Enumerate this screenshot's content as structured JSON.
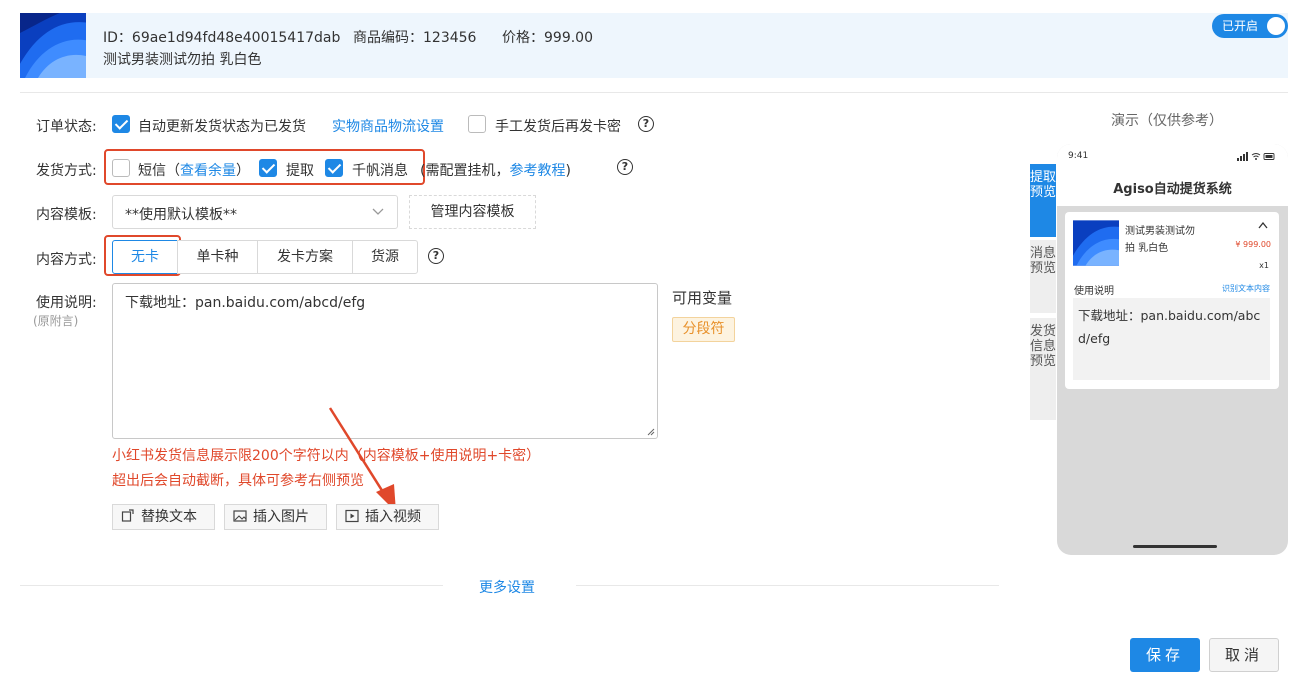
{
  "product": {
    "id_text": "ID：69ae1d94fd48e40015417dab",
    "code_text": "商品编码：123456",
    "price_text": "价格：999.00",
    "name": "测试男装测试勿拍 乳白色",
    "toggle_label": "已开启"
  },
  "order_status": {
    "label": "订单状态:",
    "auto_update": "自动更新发货状态为已发货",
    "logistics_link": "实物商品物流设置",
    "manual_resend": "手工发货后再发卡密"
  },
  "delivery": {
    "label": "发货方式:",
    "sms": "短信（",
    "sms_link": "查看余量",
    "sms_close": "）",
    "pickup": "提取",
    "qianfan": "千帆消息",
    "note_pre": "(需配置挂机，",
    "note_link": "参考教程",
    "note_post": ")"
  },
  "template": {
    "label": "内容模板:",
    "selected": "**使用默认模板**",
    "manage_button": "管理内容模板"
  },
  "content_mode": {
    "label": "内容方式:",
    "options": [
      "无卡",
      "单卡种",
      "发卡方案",
      "货源"
    ]
  },
  "instructions": {
    "label": "使用说明:",
    "sublabel": "(原附言)",
    "value": "下载地址：pan.baidu.com/abcd/efg",
    "variables_label": "可用变量",
    "variable_tag": "分段符",
    "warning_1": "小红书发货信息展示限200个字符以内（内容模板+使用说明+卡密）",
    "warning_2": "超出后会自动截断，具体可参考右侧预览"
  },
  "tools": {
    "replace_text": "替换文本",
    "insert_image": "插入图片",
    "insert_video": "插入视频"
  },
  "more_settings": "更多设置",
  "preview": {
    "title": "演示（仅供参考）",
    "tabs": [
      "提取预览",
      "消息预览",
      "发货信息预览"
    ],
    "time": "9:41",
    "app_title": "Agiso自动提货系统",
    "item_name_1": "测试男装测试勿",
    "item_name_2": "拍 乳白色",
    "item_price": "¥ 999.00",
    "item_qty": "x1",
    "usage_label": "使用说明",
    "recognize_link": "识别文本内容",
    "usage_text_1": "下载地址：pan.baidu.com/abc",
    "usage_text_2": "d/efg"
  },
  "footer": {
    "save": "保存",
    "cancel": "取消"
  },
  "colors": {
    "accent": "#1e88e5",
    "highlight": "#e0482b",
    "tag_bg": "#fdf3e0",
    "tag_fg": "#e8912b"
  }
}
